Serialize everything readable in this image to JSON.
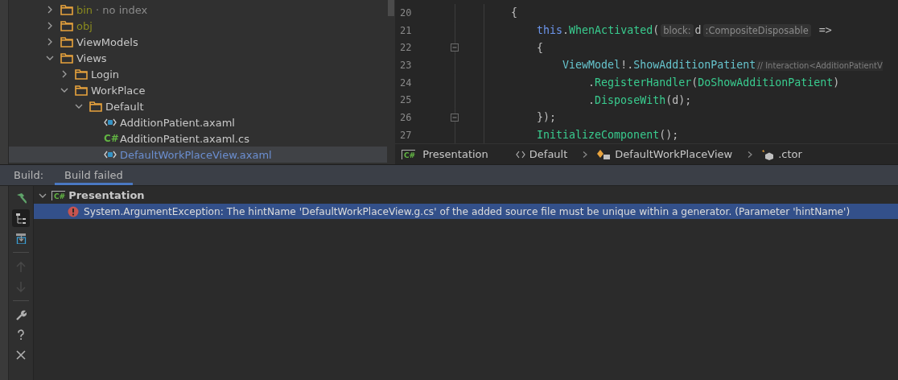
{
  "project_tree": {
    "items": [
      {
        "name": "bin",
        "note": "· no index",
        "kind": "folder",
        "excluded": true,
        "expanded": false,
        "selected": false
      },
      {
        "name": "obj",
        "kind": "folder",
        "excluded": true,
        "expanded": false,
        "selected": false
      },
      {
        "name": "ViewModels",
        "kind": "folder",
        "excluded": false,
        "expanded": false,
        "selected": false
      },
      {
        "name": "Views",
        "kind": "folder",
        "excluded": false,
        "expanded": true,
        "selected": false,
        "children": [
          {
            "name": "Login",
            "kind": "folder",
            "excluded": false,
            "expanded": false,
            "selected": false
          },
          {
            "name": "WorkPlace",
            "kind": "folder",
            "excluded": false,
            "expanded": true,
            "selected": false,
            "children": [
              {
                "name": "Default",
                "kind": "folder",
                "excluded": false,
                "expanded": true,
                "selected": false,
                "children": [
                  {
                    "name": "AdditionPatient.axaml",
                    "kind": "axaml",
                    "selected": false
                  },
                  {
                    "name": "AdditionPatient.axaml.cs",
                    "kind": "cs",
                    "badge": "C#",
                    "selected": false
                  },
                  {
                    "name": "DefaultWorkPlaceView.axaml",
                    "kind": "axaml",
                    "selected": true
                  }
                ]
              }
            ]
          }
        ]
      }
    ]
  },
  "editor": {
    "lines": [
      {
        "number": "20",
        "foldable": false,
        "tokens": [
          {
            "kind": "plain",
            "text": "    {"
          }
        ]
      },
      {
        "number": "21",
        "foldable": false,
        "tokens": [
          {
            "kind": "keyword",
            "text": "        this"
          },
          {
            "kind": "plain",
            "text": "."
          },
          {
            "kind": "method",
            "text": "WhenActivated"
          },
          {
            "kind": "plain",
            "text": "("
          },
          {
            "kind": "hint",
            "text": "block:"
          },
          {
            "kind": "plain",
            "text": "d"
          },
          {
            "kind": "hint",
            "text": ":CompositeDisposable"
          },
          {
            "kind": "plain",
            "text": " =>"
          }
        ]
      },
      {
        "number": "22",
        "foldable": true,
        "tokens": [
          {
            "kind": "plain",
            "text": "        {"
          }
        ]
      },
      {
        "number": "23",
        "foldable": false,
        "tokens": [
          {
            "kind": "property",
            "text": "            ViewModel"
          },
          {
            "kind": "plain",
            "text": "!."
          },
          {
            "kind": "property",
            "text": "ShowAdditionPatient"
          },
          {
            "kind": "comment",
            "text": "// Interaction<AdditionPatientV"
          }
        ]
      },
      {
        "number": "24",
        "foldable": false,
        "tokens": [
          {
            "kind": "plain",
            "text": "                ."
          },
          {
            "kind": "method",
            "text": "RegisterHandler"
          },
          {
            "kind": "plain",
            "text": "("
          },
          {
            "kind": "method",
            "text": "DoShowAdditionPatient"
          },
          {
            "kind": "plain",
            "text": ")"
          }
        ]
      },
      {
        "number": "25",
        "foldable": false,
        "tokens": [
          {
            "kind": "plain",
            "text": "                ."
          },
          {
            "kind": "method",
            "text": "DisposeWith"
          },
          {
            "kind": "plain",
            "text": "(d);"
          }
        ]
      },
      {
        "number": "26",
        "foldable": true,
        "tokens": [
          {
            "kind": "plain",
            "text": "        });"
          }
        ]
      },
      {
        "number": "27",
        "foldable": false,
        "tokens": [
          {
            "kind": "method",
            "text": "        InitializeComponent"
          },
          {
            "kind": "plain",
            "text": "();"
          }
        ]
      }
    ]
  },
  "breadcrumb": [
    {
      "kind": "project",
      "badge": "C#",
      "text": "Presentation",
      "separator_before": false
    },
    {
      "kind": "namespace",
      "text": "Default",
      "separator_before": false
    },
    {
      "kind": "class",
      "text": "DefaultWorkPlaceView",
      "separator_before": true
    },
    {
      "kind": "method",
      "text": ".ctor",
      "separator_before": true
    }
  ],
  "build_panel": {
    "label": "Build:",
    "tabs": [
      {
        "label": "Build failed",
        "selected": true
      }
    ],
    "toolbar": [
      {
        "kind": "hammer",
        "selected": false,
        "disabled": false
      },
      {
        "kind": "tree",
        "selected": true,
        "disabled": false
      },
      {
        "kind": "export",
        "selected": false,
        "disabled": false
      },
      {
        "kind": "separator"
      },
      {
        "kind": "up",
        "selected": false,
        "disabled": true
      },
      {
        "kind": "down",
        "selected": false,
        "disabled": true
      },
      {
        "kind": "separator"
      },
      {
        "kind": "wrench",
        "selected": false,
        "disabled": false
      },
      {
        "kind": "help",
        "selected": false,
        "disabled": false
      },
      {
        "kind": "close",
        "selected": false,
        "disabled": false
      }
    ],
    "tree": [
      {
        "kind": "project",
        "badge": "C#",
        "text": "Presentation",
        "expanded": true,
        "selected": false,
        "children": [
          {
            "kind": "error",
            "text": "System.ArgumentException: The hintName 'DefaultWorkPlaceView.g.cs' of the added source file must be unique within a generator. (Parameter 'hintName')",
            "selected": true
          }
        ]
      }
    ]
  }
}
